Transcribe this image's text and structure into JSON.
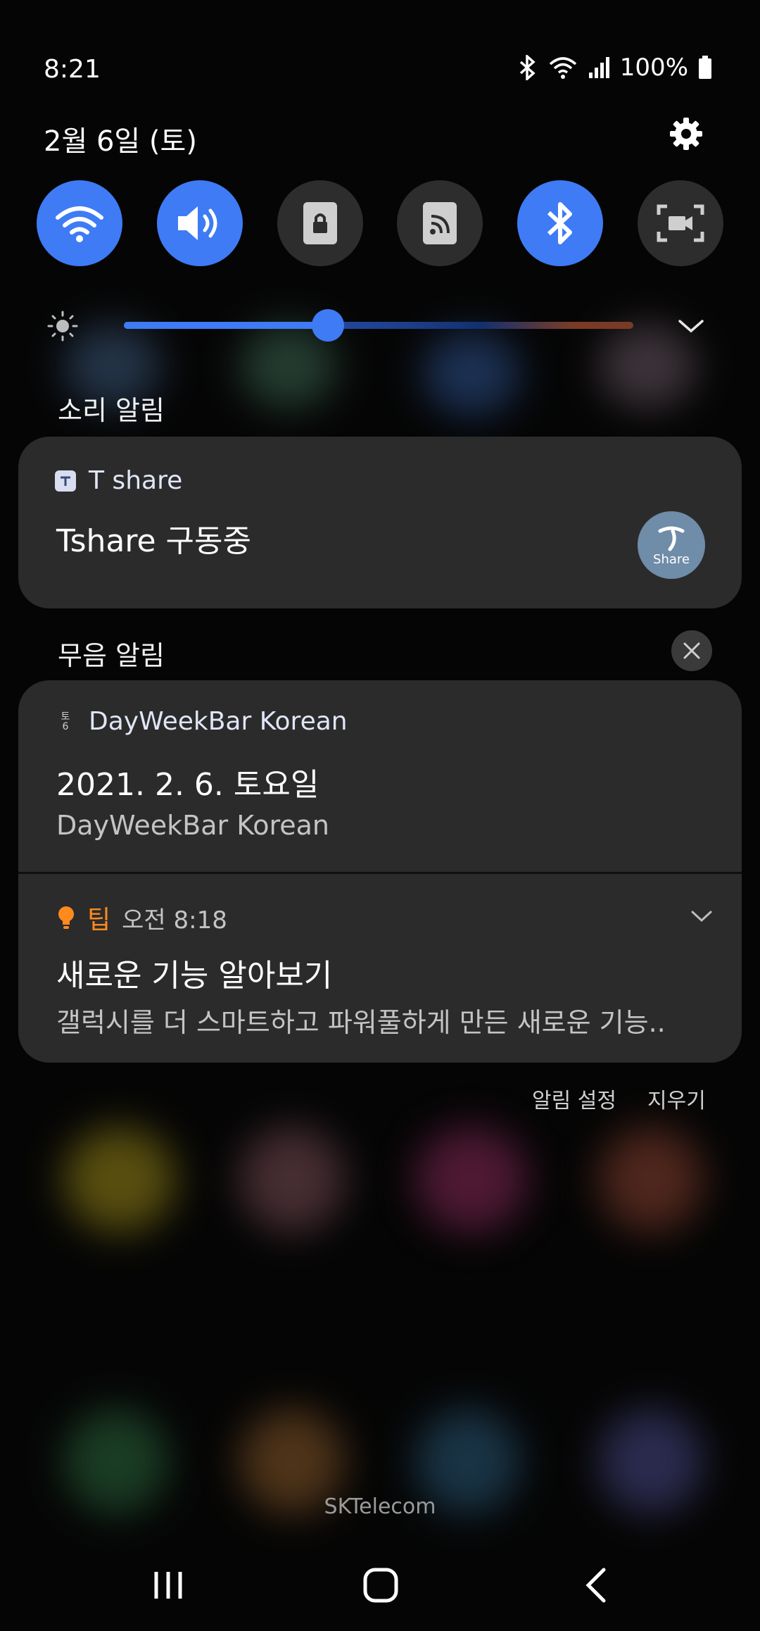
{
  "status_bar": {
    "time": "8:21",
    "battery": "100%"
  },
  "header": {
    "date": "2월 6일 (토)"
  },
  "quick_settings": [
    {
      "icon": "wifi-icon",
      "on": true
    },
    {
      "icon": "sound-icon",
      "on": true
    },
    {
      "icon": "lock-icon",
      "on": false
    },
    {
      "icon": "cast-icon",
      "on": false
    },
    {
      "icon": "bluetooth-icon",
      "on": true
    },
    {
      "icon": "screen-record-icon",
      "on": false
    }
  ],
  "brightness": {
    "level": 0.4
  },
  "sections": {
    "sound": "소리 알림",
    "silent": "무음 알림"
  },
  "notifications": {
    "tshare": {
      "app": "T share",
      "title": "Tshare 구동중",
      "badge": "Share"
    },
    "dayweek": {
      "app": "DayWeekBar Korean",
      "icon_top": "토",
      "icon_bottom": "6",
      "title": "2021. 2. 6. 토요일",
      "text": "DayWeekBar Korean"
    },
    "tip": {
      "app": "팁",
      "time": "오전 8:18",
      "title": "새로운 기능 알아보기",
      "text": "갤럭시를 더 스마트하고 파워풀하게 만든 새로운 기능..",
      "accent": "#ff8a1e"
    }
  },
  "footer": {
    "settings": "알림 설정",
    "clear": "지우기"
  },
  "carrier": "SKTelecom"
}
